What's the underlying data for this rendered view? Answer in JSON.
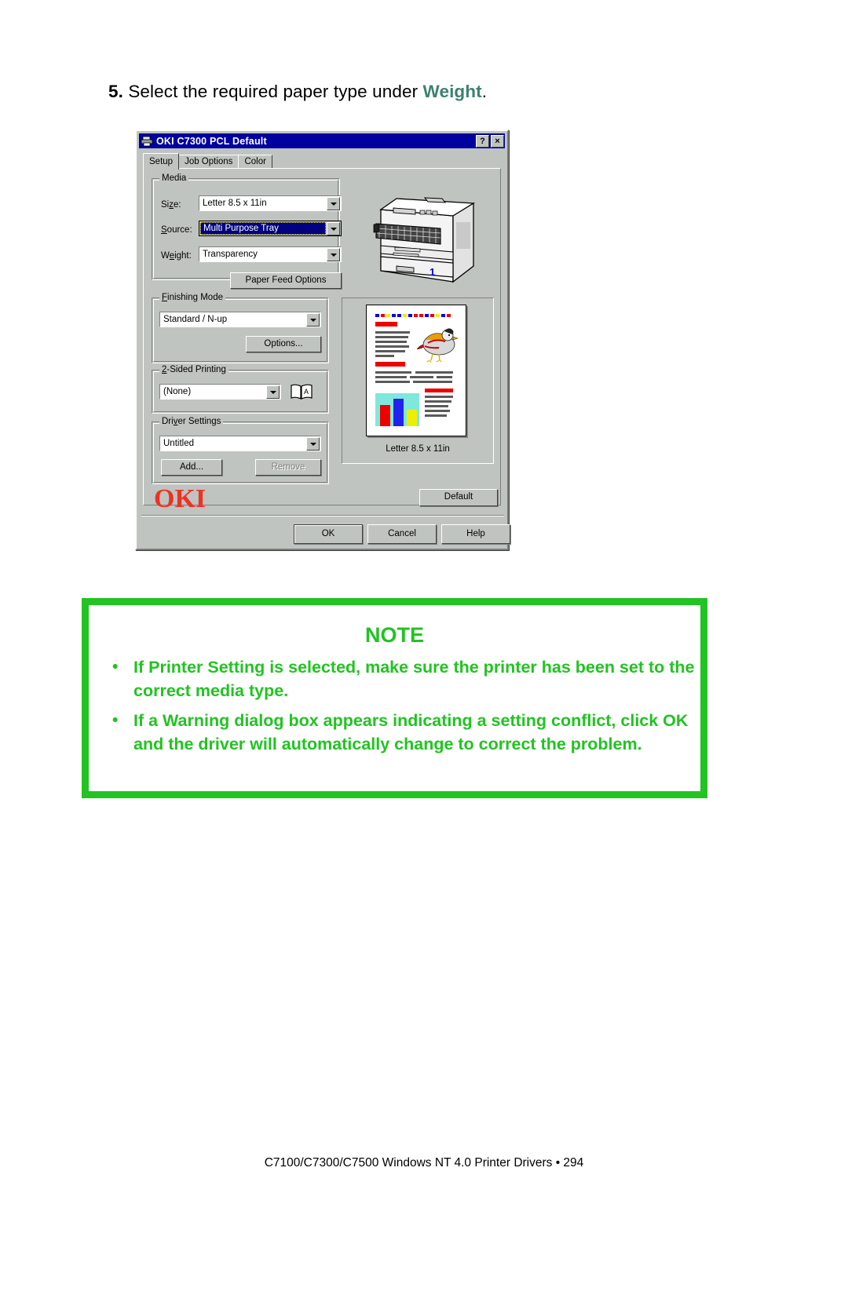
{
  "step": {
    "number": "5.",
    "text_before": "Select the required paper type under ",
    "highlight": "Weight",
    "text_after": "."
  },
  "dialog": {
    "title": "OKI C7300 PCL Default",
    "title_icon": "printer-icon",
    "help_button": "?",
    "close_button": "×",
    "tabs": [
      {
        "label": "Setup",
        "active": true
      },
      {
        "label": "Job Options",
        "active": false
      },
      {
        "label": "Color",
        "active": false
      }
    ],
    "media": {
      "group_label": "Media",
      "size_label": "Size:",
      "size_value": "Letter 8.5 x 11in",
      "source_label": "Source:",
      "source_value": "Multi Purpose Tray",
      "weight_label": "Weight:",
      "weight_value": "Transparency",
      "paper_feed_options_button": "Paper Feed Options"
    },
    "finishing": {
      "group_label": "Finishing Mode",
      "value": "Standard / N-up",
      "options_button": "Options..."
    },
    "two_sided": {
      "group_label": "2-Sided Printing",
      "value": "(None)",
      "book_icon": "duplex-book-icon"
    },
    "driver_settings": {
      "group_label": "Driver Settings",
      "value": "Untitled",
      "add_button": "Add...",
      "remove_button": "Remove"
    },
    "preview": {
      "printer_image": "printer-illustration",
      "page_preview_image": "page-preview-thumbnail",
      "caption": "Letter 8.5 x 11in"
    },
    "brand_logo": "OKI",
    "default_button": "Default",
    "footer_buttons": {
      "ok": "OK",
      "cancel": "Cancel",
      "help": "Help"
    }
  },
  "note": {
    "title": "NOTE",
    "items": [
      "If Printer Setting is selected, make sure the printer has been set to the correct media type.",
      "If a Warning dialog box appears indicating a setting conflict, click OK and the driver will automatically change to correct the problem."
    ],
    "accent_color": "#22c322"
  },
  "page_footer": {
    "text": "C7100/C7300/C7500 Windows NT 4.0 Printer Drivers • 294"
  }
}
